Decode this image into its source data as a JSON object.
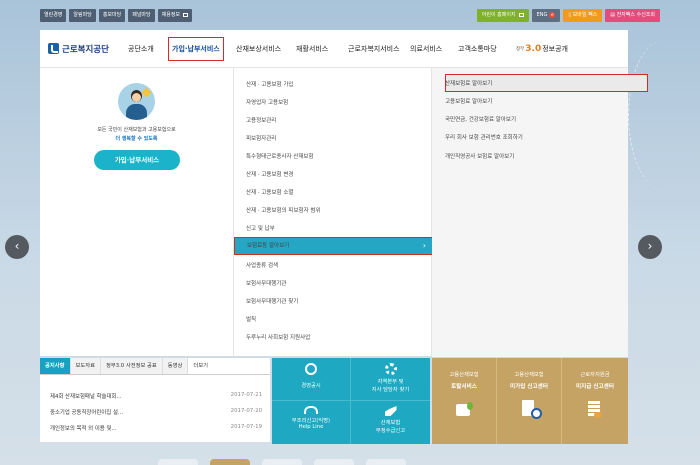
{
  "topbar": {
    "left": [
      "열린경영",
      "알림마당",
      "홍보마당",
      "패널마당",
      "채용정보"
    ],
    "kids": "어린이 홈페이지",
    "eng": "ENG",
    "mobile": "모바일 팩스",
    "fax": "전자팩스 수신조회"
  },
  "logo": {
    "name": "근로복지공단"
  },
  "nav": {
    "items": [
      "공단소개",
      "가입·납부서비스",
      "산재보상서비스",
      "재활서비스",
      "근로자복지서비스",
      "의료서비스",
      "고객소통마당"
    ],
    "gov_prefix": "정부",
    "gov_num": "3.0",
    "gov_label": "정보공개"
  },
  "dropdown": {
    "intro_line1": "모든 국민이 산재보험과 고용보험으로",
    "intro_line2": "더 행복할 수 있도록",
    "intro_button": "가입·납부서비스",
    "col2": [
      "산재 · 고용보험 가입",
      "자영업자 고용보험",
      "고용정보관리",
      "피보험자관리",
      "특수형태근로종사자 산재보험",
      "산재 · 고용보험 변경",
      "산재 · 고용보험 소멸",
      "산재 · 고용보험의 피보험자 범위",
      "신고 및 납부",
      "보험료등 알아보기",
      "사업종류 검색",
      "보험사무대행기관",
      "보험사무대행기관 찾기",
      "벌칙",
      "두루누리 사회보험 지원사업"
    ],
    "col2_highlight_index": 9,
    "col3": [
      "산재보험료 알아보기",
      "고용보험료 알아보기",
      "국민연금, 건강보험료 알아보기",
      "우리 회사 보험 관리번호 조회하기",
      "개인직영공사 보험료 알아보기"
    ]
  },
  "arrows": {
    "left": "‹",
    "right": "›"
  },
  "notice": {
    "tabs": [
      "공지사항",
      "보도자료",
      "정부3.0 사전정보 공표",
      "동영상"
    ],
    "more": "더보기",
    "rows": [
      {
        "title": "제4회 산재보험패널 학술대회...",
        "date": "2017-07-21"
      },
      {
        "title": "중소기업 공동직장어린이집 설...",
        "date": "2017-07-20"
      },
      {
        "title": "개인정보의 목적 외 이용 및...",
        "date": "2017-07-19"
      }
    ]
  },
  "tiles": {
    "t1": "경영공시",
    "t2a": "지역본부 및",
    "t2b": "지사 담당자 찾기",
    "t3a": "부조리신고(익명)",
    "t3b": "Help Line",
    "t4a": "산재보험",
    "t4b": "부정수급신고"
  },
  "gold": [
    {
      "top": "고용산재보험",
      "bottom": "토탈서비스"
    },
    {
      "top": "고용산재보험",
      "bottom": "미가입 신고센터"
    },
    {
      "top": "근로자지원금",
      "bottom": "미지급 신고센터"
    }
  ]
}
